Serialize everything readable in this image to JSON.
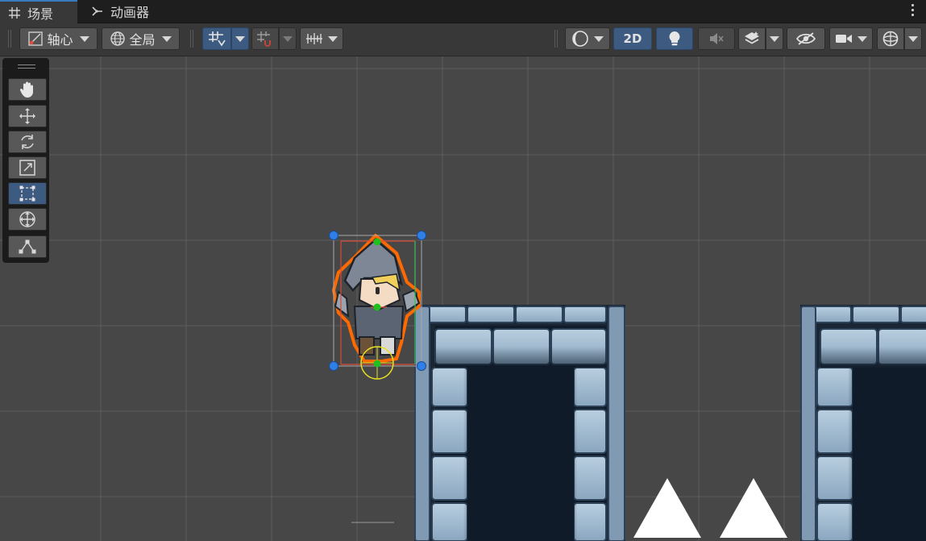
{
  "tabs": [
    {
      "label": "场景",
      "icon": "grid-hash-icon",
      "active": true
    },
    {
      "label": "动画器",
      "icon": "animator-branch-icon",
      "active": false
    }
  ],
  "toolbar": {
    "pivot_label": "轴心",
    "global_label": "全局",
    "mode_2d_label": "2D"
  },
  "tools": [
    {
      "name": "hand-tool",
      "icon": "hand-icon"
    },
    {
      "name": "move-tool",
      "icon": "move-arrows-icon"
    },
    {
      "name": "rotate-tool",
      "icon": "rotate-icon"
    },
    {
      "name": "scale-tool",
      "icon": "scale-icon"
    },
    {
      "name": "rect-tool",
      "icon": "rect-transform-icon",
      "active": true
    },
    {
      "name": "transform-tool",
      "icon": "transform-icon"
    },
    {
      "name": "custom-editor-tool",
      "icon": "custom-tool-icon"
    }
  ],
  "colors": {
    "accent": "#3d5a80",
    "tab_accent": "#3a79bb",
    "scene_bg": "#474747",
    "selection_outline": "#ff6a00",
    "handle_blue": "#2f7fe8",
    "pivot_green": "#21c021"
  }
}
